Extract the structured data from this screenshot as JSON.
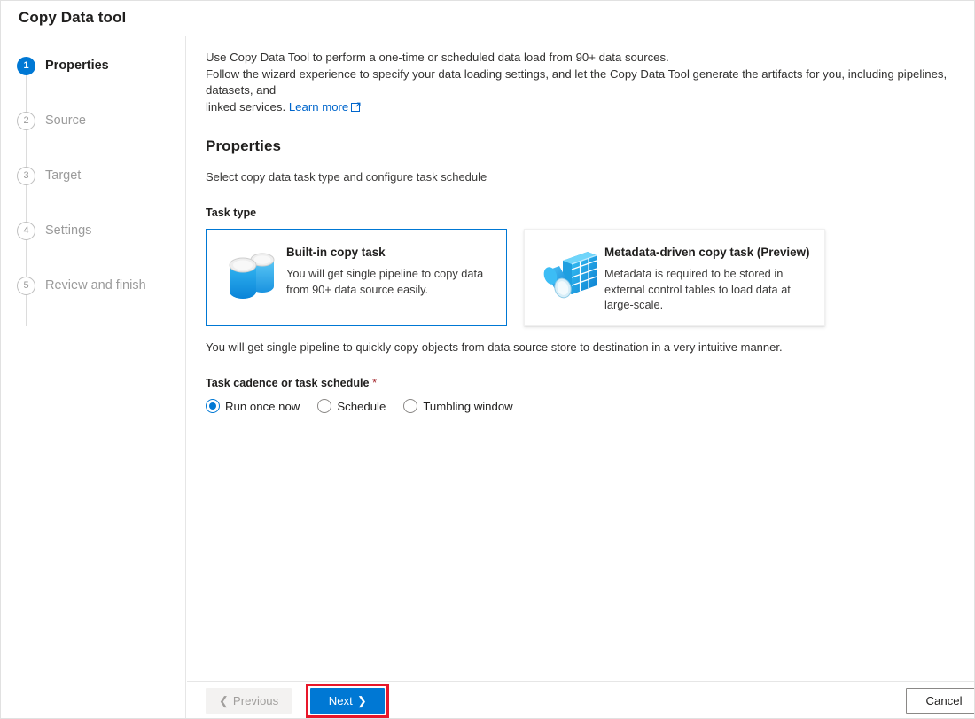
{
  "window": {
    "title": "Copy Data tool"
  },
  "sidebar": {
    "steps": [
      {
        "number": "1",
        "label": "Properties",
        "state": "active"
      },
      {
        "number": "2",
        "label": "Source",
        "state": "inactive"
      },
      {
        "number": "3",
        "label": "Target",
        "state": "inactive"
      },
      {
        "number": "4",
        "label": "Settings",
        "state": "inactive"
      },
      {
        "number": "5",
        "label": "Review and finish",
        "state": "inactive"
      }
    ]
  },
  "main": {
    "intro_line1": "Use Copy Data Tool to perform a one-time or scheduled data load from 90+ data sources.",
    "intro_line2": "Follow the wizard experience to specify your data loading settings, and let the Copy Data Tool generate the artifacts for you, including pipelines, datasets, and",
    "intro_line3_prefix": "linked services. ",
    "learn_more_label": "Learn more",
    "learn_more_icon": "external-link-icon",
    "section_title": "Properties",
    "subtitle": "Select copy data task type and configure task schedule",
    "task_type_label": "Task type",
    "cards": [
      {
        "title": "Built-in copy task",
        "description": "You will get single pipeline to copy data from 90+ data source easily.",
        "icon": "database-cylinders-icon",
        "selected": true
      },
      {
        "title": "Metadata-driven copy task (Preview)",
        "description": "Metadata is required to be stored in external control tables to load data at large-scale.",
        "icon": "metadata-table-magnifier-icon",
        "selected": false
      }
    ],
    "note": "You will get single pipeline to quickly copy objects from data source store to destination in a very intuitive manner.",
    "cadence_label": "Task cadence or task schedule",
    "cadence_required_marker": "*",
    "cadence_options": [
      {
        "label": "Run once now",
        "selected": true
      },
      {
        "label": "Schedule",
        "selected": false
      },
      {
        "label": "Tumbling window",
        "selected": false
      }
    ]
  },
  "footer": {
    "previous_label": "Previous",
    "previous_chevron": "chevron-left-icon",
    "next_label": "Next",
    "next_chevron": "chevron-right-icon",
    "cancel_label": "Cancel"
  },
  "colors": {
    "accent": "#0078d4",
    "highlight_box": "#e8172a",
    "link": "#0066cc",
    "required": "#a4262c"
  }
}
